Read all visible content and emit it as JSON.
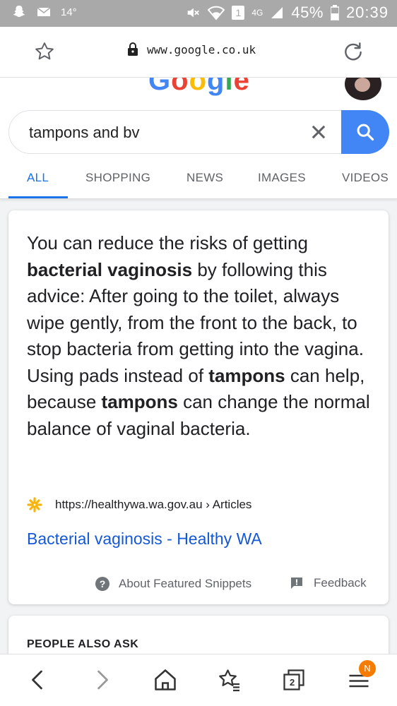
{
  "status_bar": {
    "temperature": "14°",
    "sim_number": "1",
    "network": "4G",
    "battery": "45%",
    "time": "20:39"
  },
  "address_bar": {
    "url": "www.google.co.uk"
  },
  "google": {
    "logo_text": "Google"
  },
  "search": {
    "query": "tampons and bv"
  },
  "tabs": [
    {
      "label": "ALL",
      "active": true
    },
    {
      "label": "SHOPPING",
      "active": false
    },
    {
      "label": "NEWS",
      "active": false
    },
    {
      "label": "IMAGES",
      "active": false
    },
    {
      "label": "VIDEOS",
      "active": false
    }
  ],
  "featured_snippet": {
    "parts": [
      "You can reduce the risks of getting ",
      "bacterial vaginosis",
      " by following this advice: After going to the toilet, always wipe gently, from the front to the back, to stop bacteria from getting into the vagina. Using pads instead of ",
      "tampons",
      " can help, because ",
      "tampons",
      " can change the normal balance of vaginal bacteria."
    ],
    "source_url": "https://healthywa.wa.gov.au › Articles",
    "link_title": "Bacterial vaginosis - Healthy WA",
    "about_label": "About Featured Snippets",
    "feedback_label": "Feedback"
  },
  "people_also_ask": {
    "heading": "PEOPLE ALSO ASK"
  },
  "bottom_nav": {
    "tab_count": "2",
    "notification_badge": "N"
  },
  "colors": {
    "accent": "#1a73e8",
    "search_button": "#4285f4",
    "link": "#1558d6",
    "badge": "#f57c00"
  }
}
